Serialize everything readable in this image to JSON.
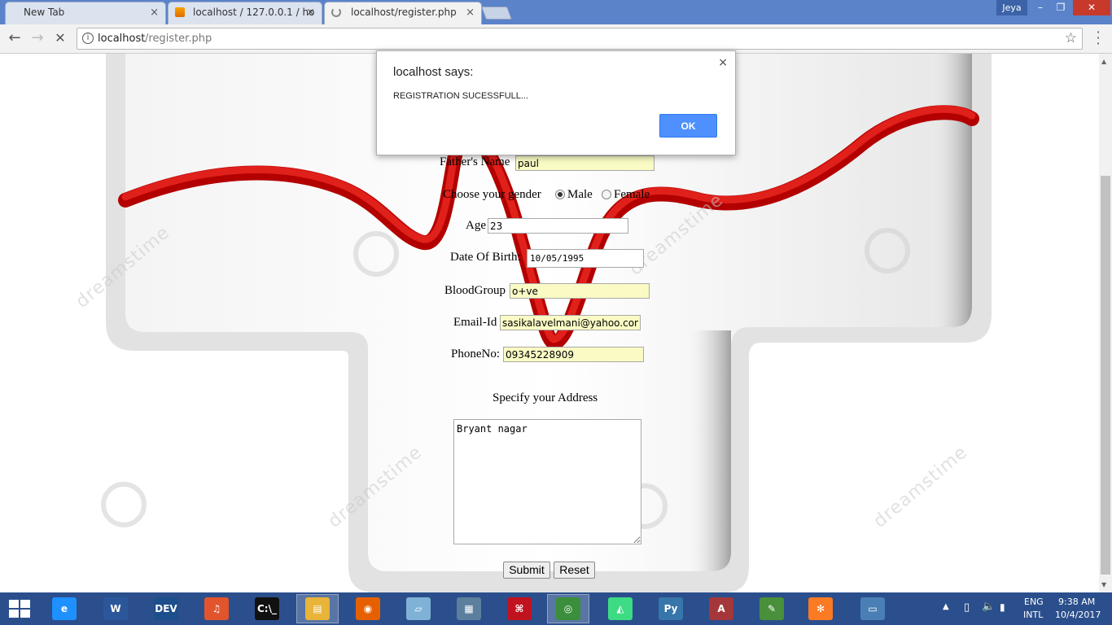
{
  "browser": {
    "tabs": [
      {
        "label": "New Tab",
        "close": "×"
      },
      {
        "label": "localhost / 127.0.0.1 / ho",
        "close": "×"
      },
      {
        "label": "localhost/register.php",
        "close": "×"
      }
    ],
    "user": "Jeya",
    "url_host": "localhost",
    "url_path": "/register.php"
  },
  "form": {
    "fathers_name_label": "Father's Name",
    "fathers_name_value": "paul",
    "gender_label": "Choose your gender",
    "gender_male": "Male",
    "gender_female": "Female",
    "gender_selected": "Male",
    "age_label": "Age",
    "age_value": "23",
    "dob_label": "Date Of Birth:",
    "dob_value": "10/05/1995",
    "blood_label": "BloodGroup",
    "blood_value": "o+ve",
    "email_label": "Email-Id",
    "email_value": "sasikalavelmani@yahoo.con",
    "phone_label": "PhoneNo:",
    "phone_value": "09345228909",
    "address_label": "Specify your Address",
    "address_value": "Bryant nagar",
    "submit_label": "Submit",
    "reset_label": "Reset"
  },
  "dialog": {
    "title": "localhost says:",
    "message": "REGISTRATION SUCESSFULL...",
    "ok_label": "OK",
    "close": "×"
  },
  "watermark": "dreamstime",
  "taskbar": {
    "items": [
      {
        "name": "internet-explorer-icon",
        "text": "e",
        "color": "#1e90ff"
      },
      {
        "name": "word-icon",
        "text": "W",
        "color": "#2b579a"
      },
      {
        "name": "devcpp-icon",
        "text": "DEV",
        "color": "#1c4f8c"
      },
      {
        "name": "headphones-icon",
        "text": "♫",
        "color": "#e2542c"
      },
      {
        "name": "command-prompt-icon",
        "text": "C:\\_",
        "color": "#111111"
      },
      {
        "name": "file-explorer-icon",
        "text": "▤",
        "color": "#e8b43a"
      },
      {
        "name": "firefox-icon",
        "text": "◉",
        "color": "#e66000"
      },
      {
        "name": "notes-icon",
        "text": "▱",
        "color": "#7fb2d6"
      },
      {
        "name": "document-viewer-icon",
        "text": "▦",
        "color": "#5c7f9e"
      },
      {
        "name": "pdf-reader-icon",
        "text": "⌘",
        "color": "#c1121f"
      },
      {
        "name": "chrome-icon",
        "text": "◎",
        "color": "#3b8e3b"
      },
      {
        "name": "android-studio-icon",
        "text": "◭",
        "color": "#3ddc84"
      },
      {
        "name": "python-icon",
        "text": "Py",
        "color": "#3776ab"
      },
      {
        "name": "access-icon",
        "text": "A",
        "color": "#a4373a"
      },
      {
        "name": "notepad-icon",
        "text": "✎",
        "color": "#4a8f3a"
      },
      {
        "name": "xampp-icon",
        "text": "✻",
        "color": "#fb7a24"
      },
      {
        "name": "photos-icon",
        "text": "▭",
        "color": "#4a7fb5"
      }
    ],
    "lang_top": "ENG",
    "lang_bottom": "INTL",
    "time": "9:38 AM",
    "date": "10/4/2017"
  }
}
